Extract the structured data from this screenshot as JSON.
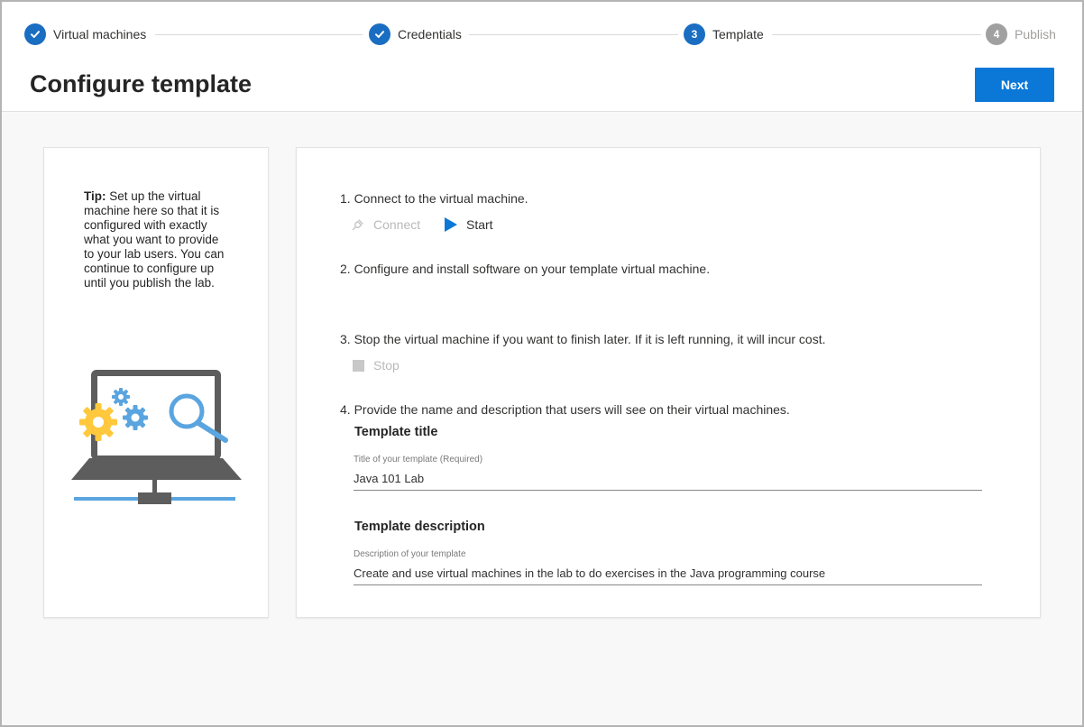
{
  "stepper": {
    "steps": [
      {
        "number": "1",
        "label": "Virtual machines",
        "state": "done"
      },
      {
        "number": "2",
        "label": "Credentials",
        "state": "done"
      },
      {
        "number": "3",
        "label": "Template",
        "state": "current"
      },
      {
        "number": "4",
        "label": "Publish",
        "state": "future"
      }
    ]
  },
  "page": {
    "title": "Configure template",
    "next_label": "Next"
  },
  "tip": {
    "prefix": "Tip:",
    "text": " Set up the virtual machine here so that it is configured with exactly what you want to provide to your lab users. You can continue to configure up until you publish the lab."
  },
  "instructions": {
    "step1": "1. Connect to the virtual machine.",
    "connect_label": "Connect",
    "start_label": "Start",
    "step2": "2. Configure and install software on your template virtual machine.",
    "step3": "3. Stop the virtual machine if you want to finish later. If it is left running, it will incur cost.",
    "stop_label": "Stop",
    "step4": "4. Provide the name and description that users will see on their virtual machines."
  },
  "template_title": {
    "heading": "Template title",
    "field_label": "Title of your template (Required)",
    "value": "Java 101 Lab"
  },
  "template_description": {
    "heading": "Template description",
    "field_label": "Description of your template",
    "value": "Create and use virtual machines in the lab to do exercises in the Java programming course"
  },
  "icons": {
    "check": "checkmark-icon",
    "connect": "plug-icon",
    "start": "play-icon",
    "stop": "stop-icon"
  },
  "colors": {
    "accent": "#0b78d8",
    "step_done": "#1a6ec2",
    "step_future": "#a0a0a0",
    "disabled_text": "#b9b9b9"
  }
}
